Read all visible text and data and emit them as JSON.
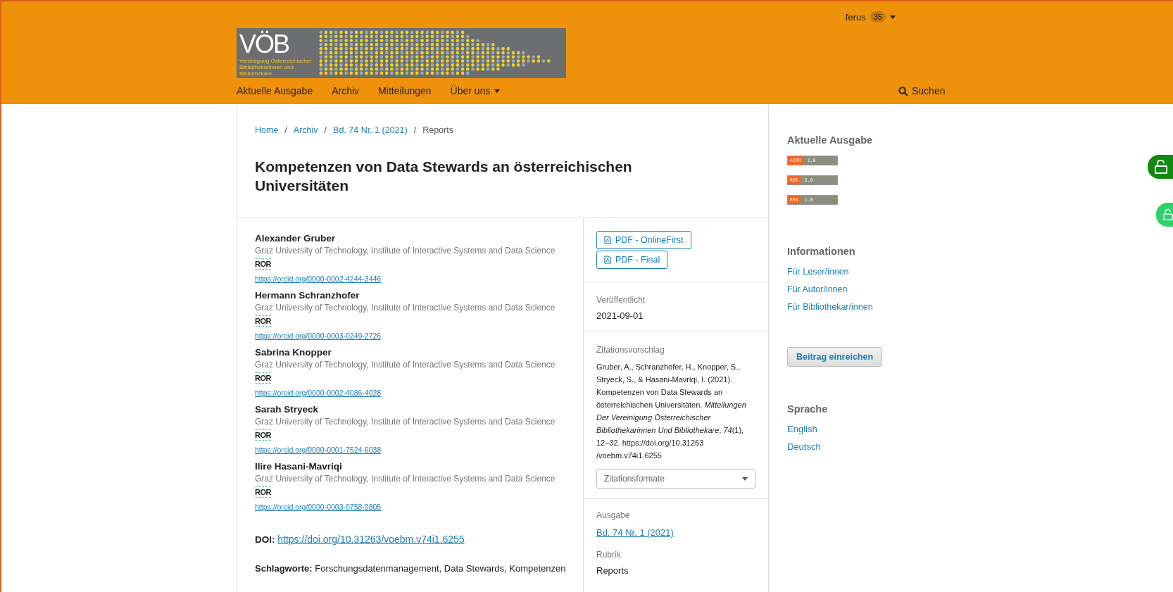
{
  "header": {
    "user": {
      "name": "ferus",
      "badge": "35"
    },
    "logo": {
      "mark": "VÖB",
      "subtitle": [
        "Vereinigung Österreichischer",
        "Bibliothekarinnen und",
        "Bibliothekare"
      ]
    },
    "nav": [
      {
        "label": "Aktuelle Ausgabe",
        "has_menu": false
      },
      {
        "label": "Archiv",
        "has_menu": false
      },
      {
        "label": "Mitteilungen",
        "has_menu": false
      },
      {
        "label": "Über uns",
        "has_menu": true
      }
    ],
    "search": "Suchen"
  },
  "breadcrumb": {
    "separator": "/",
    "items": [
      {
        "label": "Home",
        "current": false
      },
      {
        "label": "Archiv",
        "current": false
      },
      {
        "label": "Bd. 74 Nr. 1 (2021)",
        "current": false
      },
      {
        "label": "Reports",
        "current": true
      }
    ]
  },
  "title": "Kompetenzen von Data Stewards an österreichischen Universitäten",
  "authors": [
    {
      "name": "Alexander Gruber",
      "affiliation": "Graz University of Technology, Institute of Interactive Systems and Data Science",
      "ror": "ROR",
      "orcid": "https://orcid.org/0000-0002-4244-3446"
    },
    {
      "name": "Hermann Schranzhofer",
      "affiliation": "Graz University of Technology, Institute of Interactive Systems and Data Science",
      "ror": "ROR",
      "orcid": "https://orcid.org/0000-0003-0249-2726"
    },
    {
      "name": "Sabrina Knopper",
      "affiliation": "Graz University of Technology, Institute of Interactive Systems and Data Science",
      "ror": "ROR",
      "orcid": "https://orcid.org/0000-0002-4086-4028"
    },
    {
      "name": "Sarah Stryeck",
      "affiliation": "Graz University of Technology, Institute of Interactive Systems and Data Science",
      "ror": "ROR",
      "orcid": "https://orcid.org/0000-0001-7524-6038"
    },
    {
      "name": "Ilire Hasani-Mavriqi",
      "affiliation": "Graz University of Technology, Institute of Interactive Systems and Data Science",
      "ror": "ROR",
      "orcid": "https://orcid.org/0000-0003-0758-0805"
    }
  ],
  "doi": {
    "label": "DOI:",
    "url": "https://doi.org/10.31263/voebm.v74i1.6255"
  },
  "keywords": {
    "label": "Schlagworte:",
    "text": "Forschungsdatenmanagement, Data Stewards, Kompetenzen"
  },
  "galleys": [
    "PDF - OnlineFirst",
    "PDF - Final"
  ],
  "published": {
    "label": "Veröffentlicht",
    "value": "2021-09-01"
  },
  "citation": {
    "label": "Zitationsvorschlag",
    "text": "Gruber, A., Schranzhofer, H., Knopper, S., Stryeck, S., & Hasani-Mavriqi, I. (2021). Kompetenzen von Data Stewards an österreichischen Universitäten. *Mitteilungen Der Vereinigung Österreichischer Bibliothekarinnen Und Bibliothekare*, *74*(1), 12–32. https://doi.org/10.31263 /voebm.v74i1.6255",
    "formats": "Zitationsformate"
  },
  "issue": {
    "label": "Ausgabe",
    "link": "Bd. 74 Nr. 1 (2021)"
  },
  "section": {
    "label": "Rubrik",
    "value": "Reports"
  },
  "sidebar": {
    "current_issue": {
      "title": "Aktuelle Ausgabe",
      "feeds": [
        {
          "type": "ATOM",
          "version": "1.0"
        },
        {
          "type": "RSS",
          "version": "2.0"
        },
        {
          "type": "RSS",
          "version": "1.0"
        }
      ]
    },
    "information": {
      "title": "Informationen",
      "links": [
        "Für Leser/innen",
        "Für Autor/innen",
        "Für Bibliothekar/innen"
      ]
    },
    "submit": "Beitrag einreichen",
    "language": {
      "title": "Sprache",
      "links": [
        "English",
        "Deutsch"
      ]
    }
  }
}
